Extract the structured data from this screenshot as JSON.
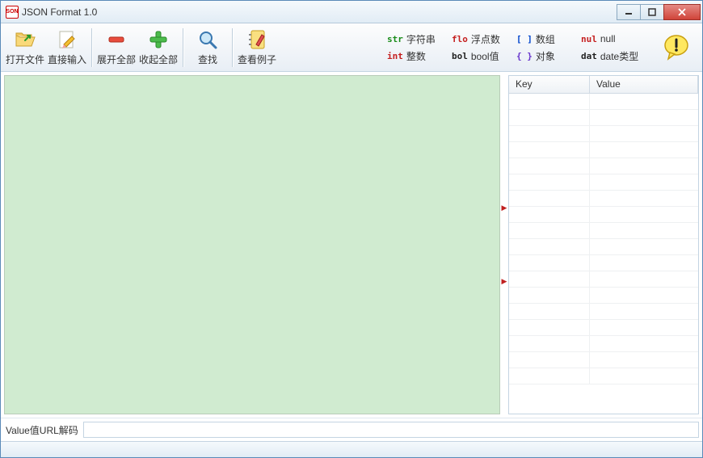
{
  "title": "JSON Format 1.0",
  "toolbar": {
    "open": "打开文件",
    "input": "直接输入",
    "expand": "展开全部",
    "collapse": "收起全部",
    "find": "查找",
    "example": "查看例子"
  },
  "legend": {
    "str": {
      "tag": "str",
      "label": "字符串"
    },
    "flo": {
      "tag": "flo",
      "label": "浮点数"
    },
    "arr": {
      "tag": "[ ]",
      "label": "数组"
    },
    "nul": {
      "tag": "nul",
      "label": "null"
    },
    "int": {
      "tag": "int",
      "label": "整数"
    },
    "bol": {
      "tag": "bol",
      "label": "bool值"
    },
    "obj": {
      "tag": "{ }",
      "label": "对象"
    },
    "dat": {
      "tag": "dat",
      "label": "date类型"
    }
  },
  "grid": {
    "key_header": "Key",
    "val_header": "Value"
  },
  "bottom": {
    "label": "Value值URL解码",
    "value": ""
  }
}
